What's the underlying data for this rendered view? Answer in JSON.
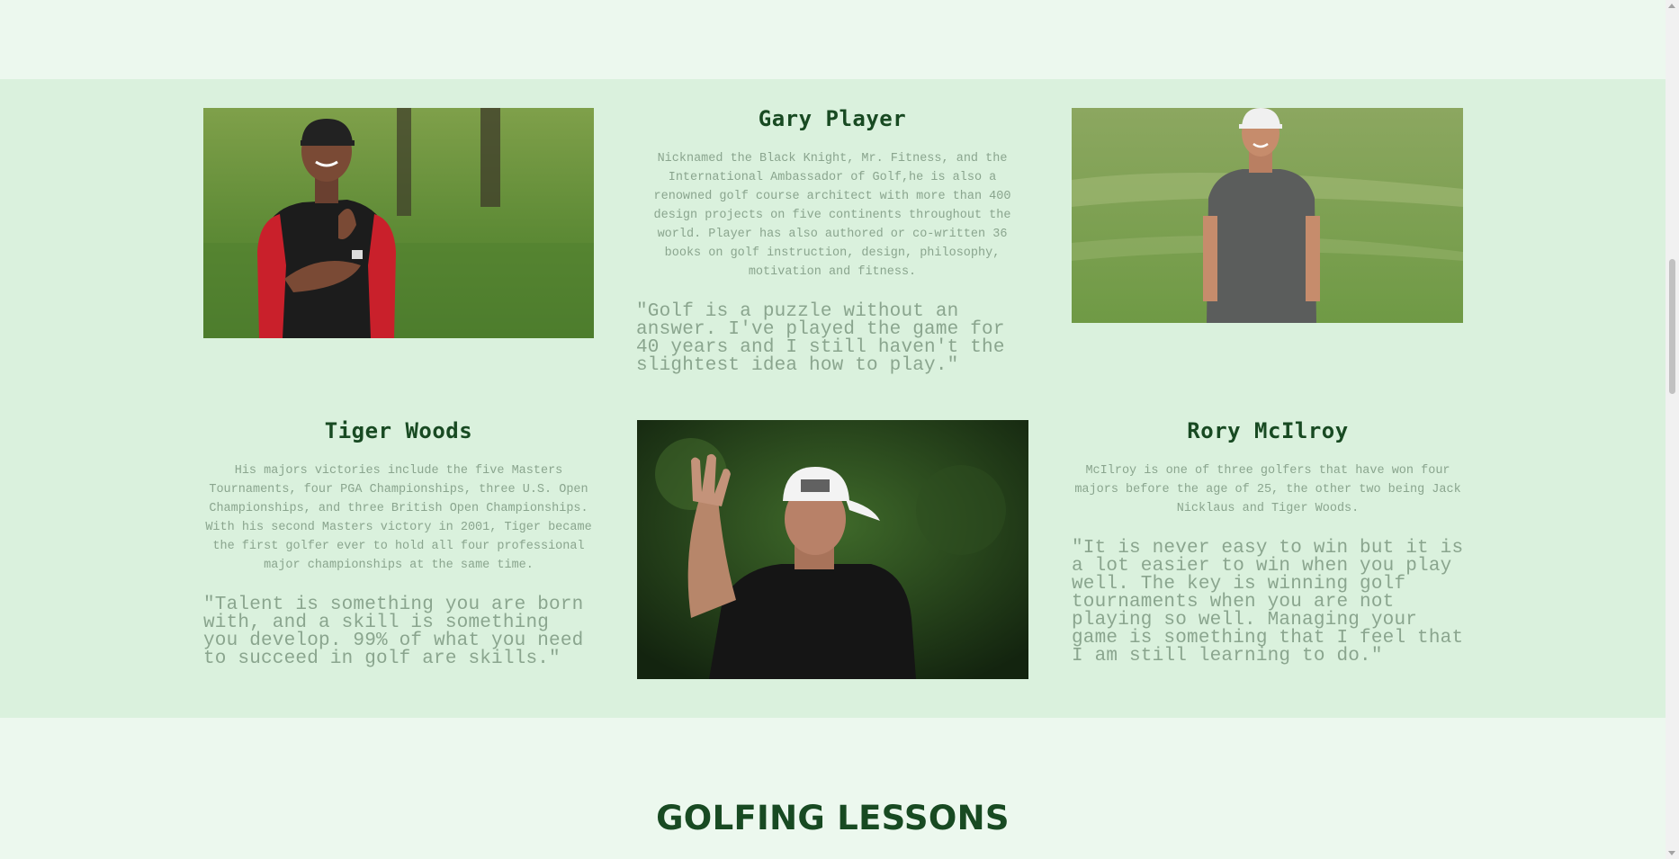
{
  "golfers": {
    "gary": {
      "name": "Gary Player",
      "bio": "Nicknamed the Black Knight, Mr. Fitness, and the International Ambassador of Golf,he is also a renowned golf course architect with more than 400 design projects on five continents throughout the world. Player has also authored or co-written 36 books on golf instruction, design, philosophy, motivation and fitness.",
      "quote": "\"Golf is a puzzle without an answer. I've played the game for 40 years and I still haven't the slightest idea how to play.\""
    },
    "tiger": {
      "name": "Tiger Woods",
      "bio": "His majors victories include the five Masters Tournaments, four PGA Championships, three U.S. Open Championships, and three British Open Championships. With his second Masters victory in 2001, Tiger became the first golfer ever to hold all four professional major championships at the same time.",
      "quote": "\"Talent is something you are born with, and a skill is something you develop. 99% of what you need to succeed in golf are skills.\""
    },
    "rory": {
      "name": "Rory McIlroy",
      "bio": "McIlroy is one of three golfers that have won four majors before the age of 25, the other two being Jack Nicklaus and Tiger Woods.",
      "quote": "\"It is never easy to win but it is a lot easier to win when you play well. The key is winning golf tournaments when you are not playing so well. Managing your game is something that I feel that I am still learning to do.\""
    }
  },
  "lessons": {
    "title": "GOLFING LESSONS"
  },
  "colors": {
    "section_bg": "#daf1dd",
    "page_bg": "#ecf8ee",
    "heading": "#184a22",
    "body_text": "#8aa58e"
  }
}
